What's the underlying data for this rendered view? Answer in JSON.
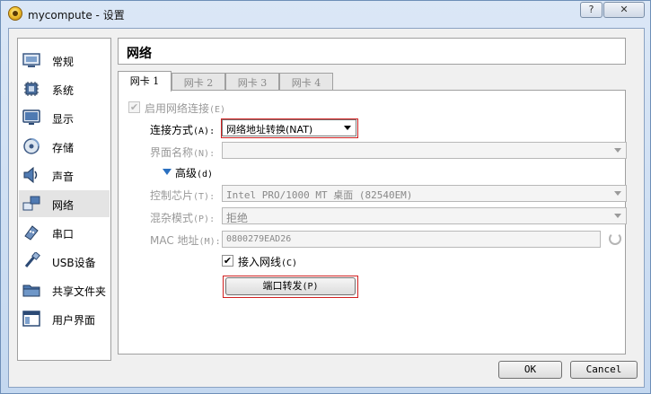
{
  "window": {
    "title": "mycompute - 设置",
    "help_label": "?",
    "close_label": "✕"
  },
  "sidebar": {
    "items": [
      {
        "label": "常规",
        "icon": "general-icon"
      },
      {
        "label": "系统",
        "icon": "system-icon"
      },
      {
        "label": "显示",
        "icon": "display-icon"
      },
      {
        "label": "存储",
        "icon": "storage-icon"
      },
      {
        "label": "声音",
        "icon": "audio-icon"
      },
      {
        "label": "网络",
        "icon": "network-icon",
        "selected": true
      },
      {
        "label": "串口",
        "icon": "serial-port-icon"
      },
      {
        "label": "USB设备",
        "icon": "usb-icon"
      },
      {
        "label": "共享文件夹",
        "icon": "shared-folder-icon"
      },
      {
        "label": "用户界面",
        "icon": "user-interface-icon"
      }
    ]
  },
  "panel": {
    "title": "网络"
  },
  "tabs": [
    {
      "label": "网卡 1",
      "active": true
    },
    {
      "label": "网卡 2",
      "active": false
    },
    {
      "label": "网卡 3",
      "active": false
    },
    {
      "label": "网卡 4",
      "active": false
    }
  ],
  "form": {
    "enable_label": "启用网络连接",
    "enable_acc": "(E)",
    "enable_checked": true,
    "attached_label": "连接方式",
    "attached_acc": "(A):",
    "attached_value": "网络地址转换(NAT)",
    "name_label": "界面名称",
    "name_acc": "(N):",
    "name_value": "",
    "advanced_label": "高级",
    "advanced_acc": "(d)",
    "adapter_label": "控制芯片",
    "adapter_acc": "(T):",
    "adapter_value": "Intel PRO/1000 MT 桌面 (82540EM)",
    "promisc_label": "混杂模式",
    "promisc_acc": "(P):",
    "promisc_value": "拒绝",
    "mac_label": "MAC 地址",
    "mac_acc": "(M):",
    "mac_value": "0800279EAD26",
    "cable_label": "接入网线",
    "cable_acc": "(C)",
    "cable_checked": true,
    "port_forward_label": "端口转发",
    "port_forward_acc": "(P)"
  },
  "footer": {
    "ok_label": "OK",
    "cancel_label": "Cancel"
  },
  "colors": {
    "highlight": "#d02020",
    "advanced_arrow": "#2a70c0"
  }
}
